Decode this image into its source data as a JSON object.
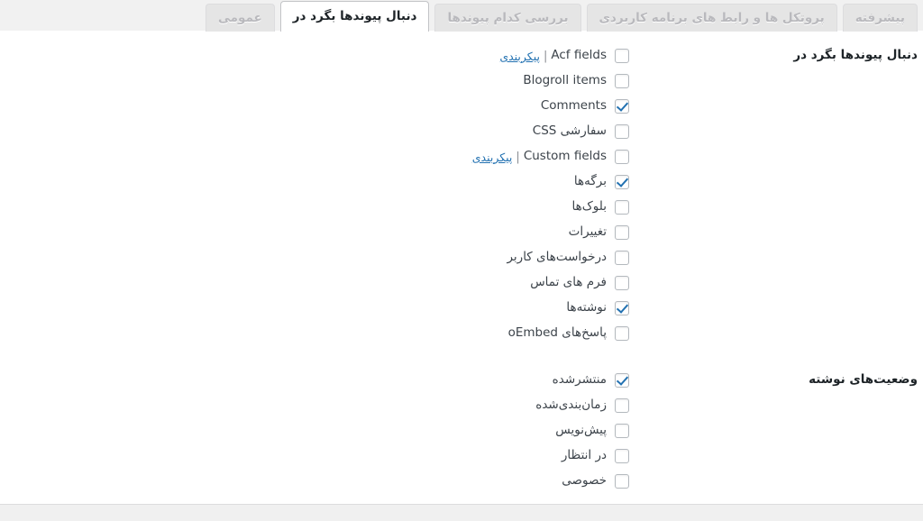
{
  "tabs": [
    {
      "label": "پیشرفته",
      "active": false
    },
    {
      "label": "پروتکل ها و رابط های برنامه کاربردی",
      "active": false
    },
    {
      "label": "بررسی کدام پیوندها",
      "active": false
    },
    {
      "label": "دنبال پیوندها بگرد در",
      "active": true
    },
    {
      "label": "عمومی",
      "active": false
    }
  ],
  "sections": [
    {
      "title": "دنبال پیوندها بگرد در",
      "items": [
        {
          "label": "Acf fields",
          "checked": false,
          "link": "پیکربندی",
          "separator": "|"
        },
        {
          "label": "Blogroll items",
          "checked": false,
          "link": null,
          "separator": null
        },
        {
          "label": "Comments",
          "checked": true,
          "link": null,
          "separator": null
        },
        {
          "label": "CSS سفارشی",
          "checked": false,
          "link": null,
          "separator": null
        },
        {
          "label": "Custom fields",
          "checked": false,
          "link": "پیکربندی",
          "separator": "|"
        },
        {
          "label": "برگه‌ها",
          "checked": true,
          "link": null,
          "separator": null
        },
        {
          "label": "بلوک‌ها",
          "checked": false,
          "link": null,
          "separator": null
        },
        {
          "label": "تغییرات",
          "checked": false,
          "link": null,
          "separator": null
        },
        {
          "label": "درخواست‌های کاربر",
          "checked": false,
          "link": null,
          "separator": null
        },
        {
          "label": "فرم های تماس",
          "checked": false,
          "link": null,
          "separator": null
        },
        {
          "label": "نوشته‌ها",
          "checked": true,
          "link": null,
          "separator": null
        },
        {
          "label": "پاسخ‌های oEmbed",
          "checked": false,
          "link": null,
          "separator": null
        }
      ]
    },
    {
      "title": "وضعیت‌های نوشته",
      "items": [
        {
          "label": "منتشرشده",
          "checked": true,
          "link": null,
          "separator": null
        },
        {
          "label": "زمان‌بندی‌شده",
          "checked": false,
          "link": null,
          "separator": null
        },
        {
          "label": "پیش‌نویس",
          "checked": false,
          "link": null,
          "separator": null
        },
        {
          "label": "در انتظار",
          "checked": false,
          "link": null,
          "separator": null
        },
        {
          "label": "خصوصی",
          "checked": false,
          "link": null,
          "separator": null
        }
      ]
    }
  ],
  "colors": {
    "accent": "#2271b1",
    "page_bg": "#f1f1f1",
    "panel_bg": "#ffffff",
    "tab_inactive_bg": "#e5e5e5",
    "border": "#c3c4c7",
    "text": "#3c434a",
    "muted_text": "#b9b9bd"
  }
}
